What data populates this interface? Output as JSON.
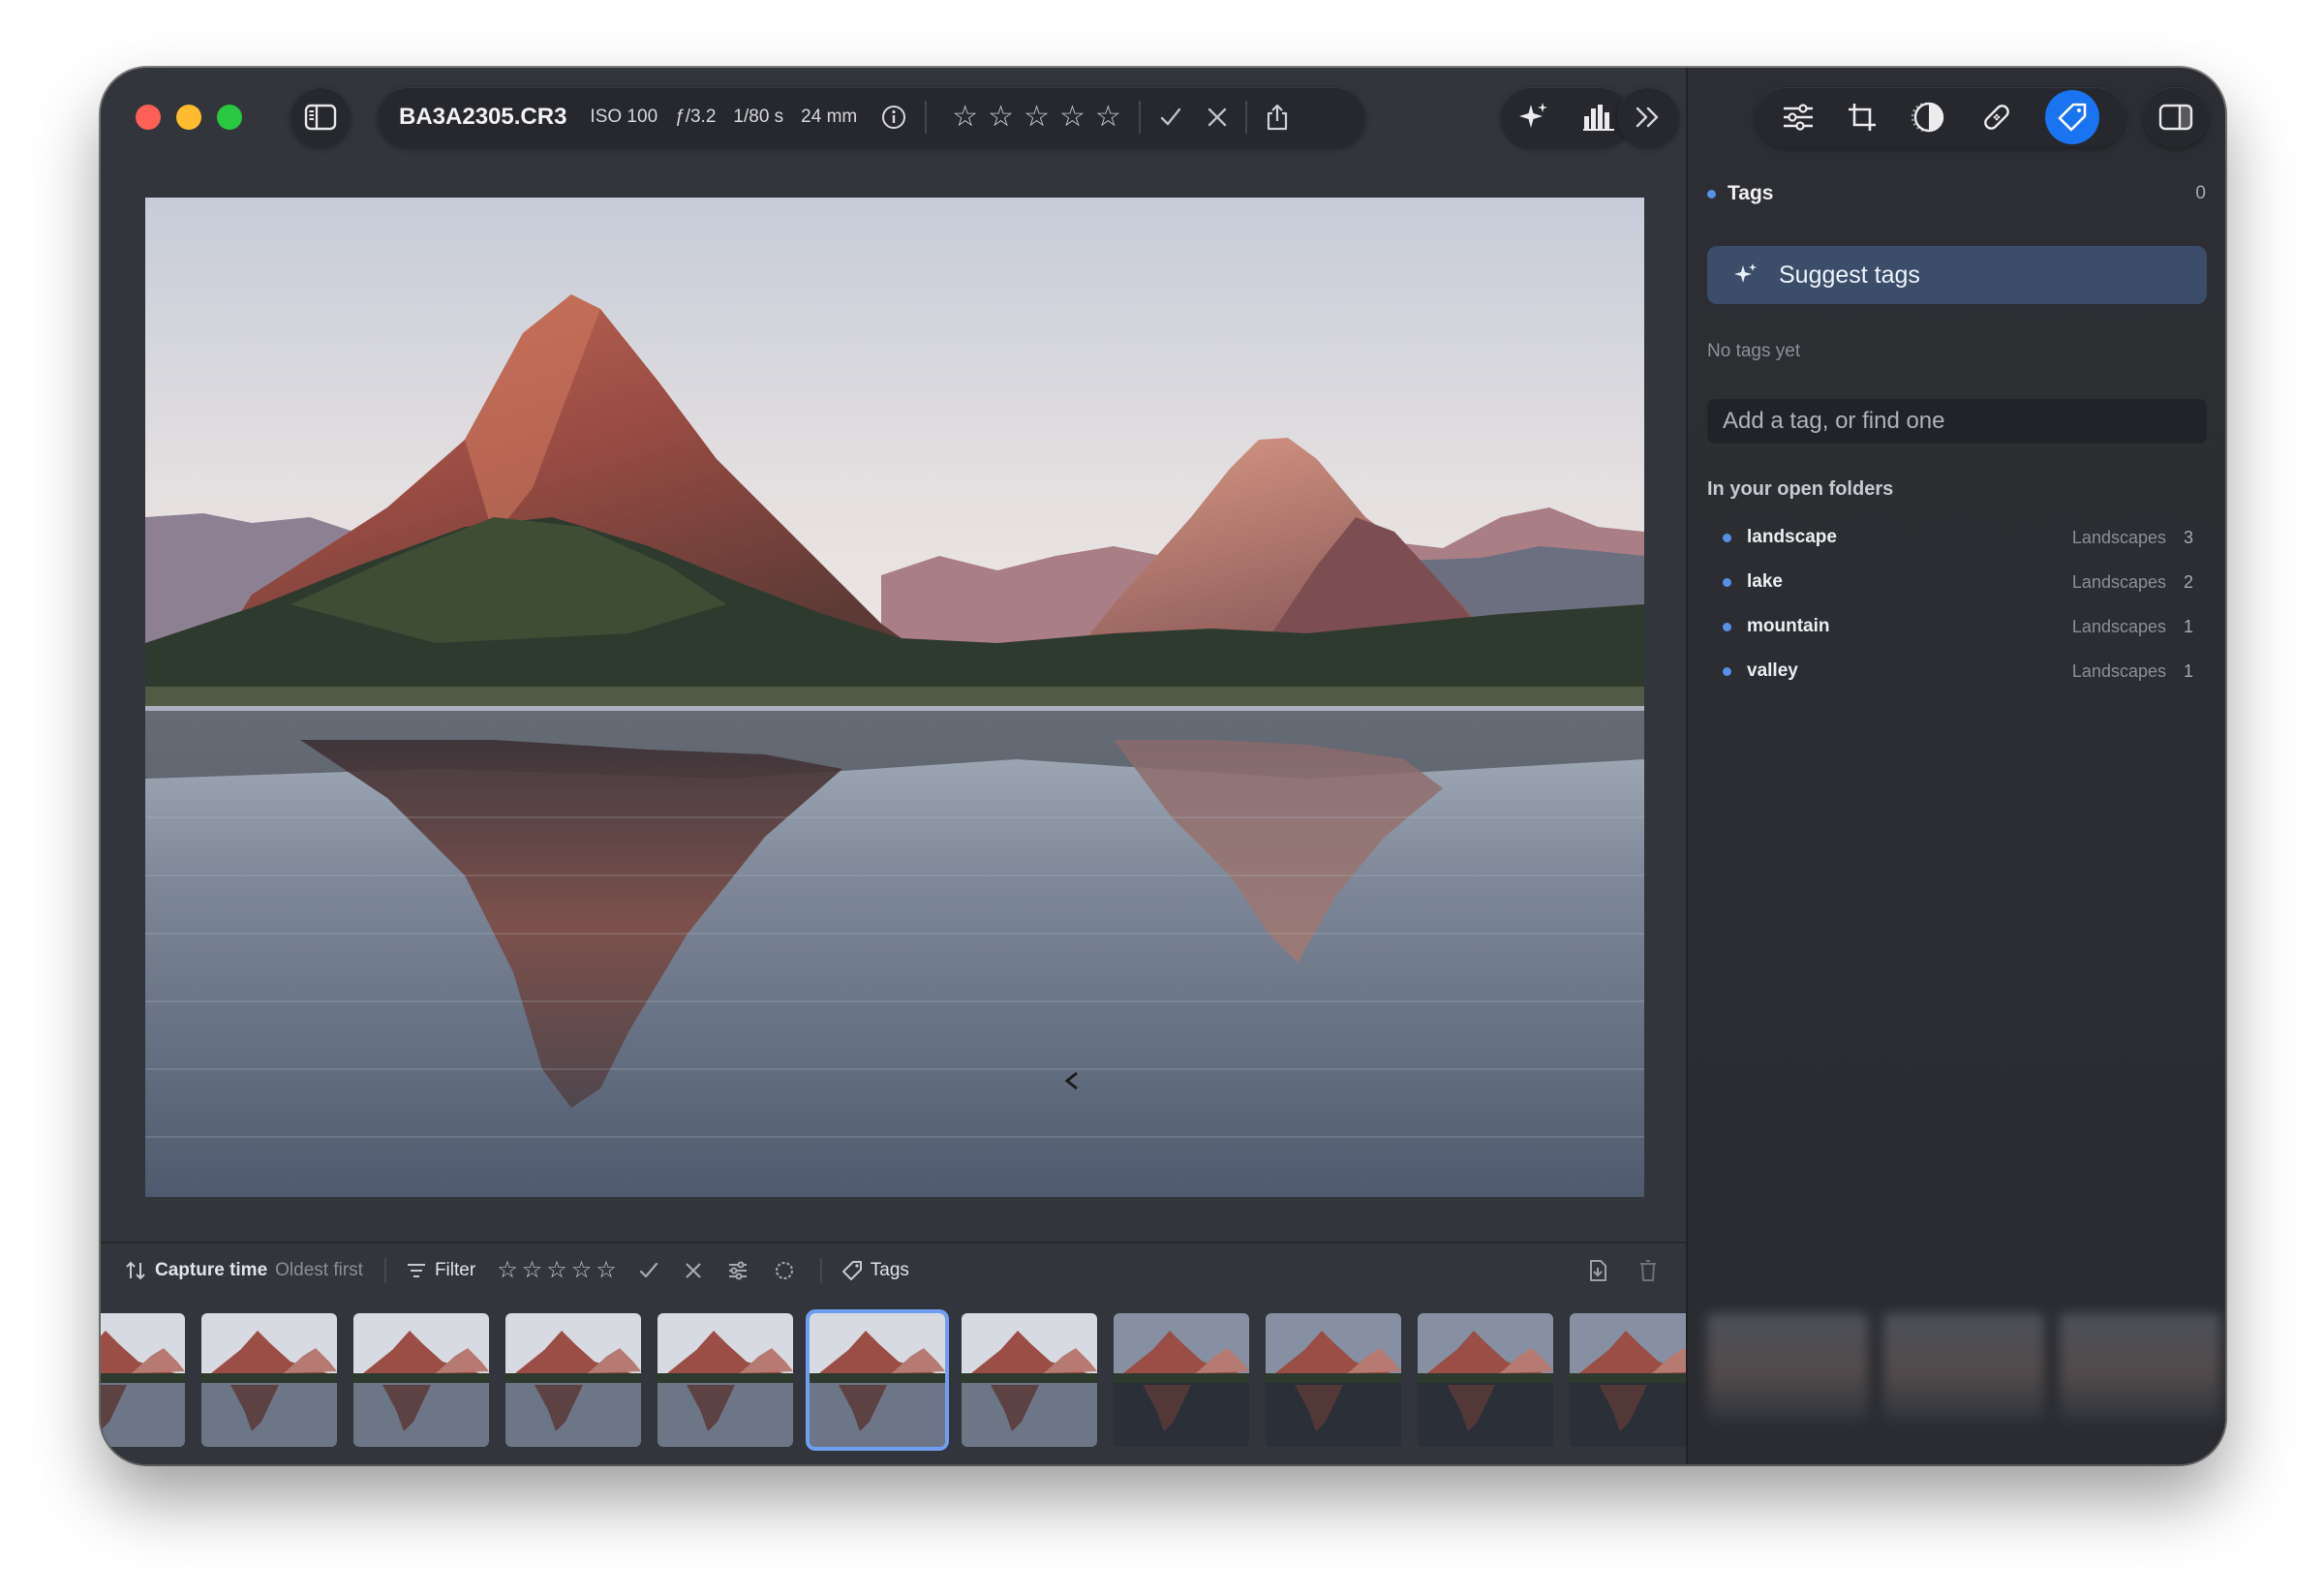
{
  "toolbar": {
    "filename": "BA3A2305.CR3",
    "iso": "ISO 100",
    "aperture": "ƒ/3.2",
    "shutter": "1/80 s",
    "focal": "24 mm",
    "rating": 0,
    "rating_max": 5,
    "icons": [
      "sidebar-left-icon",
      "info-icon",
      "check-icon",
      "x-icon",
      "share-icon",
      "sparkle-icon",
      "histogram-icon",
      "chevron-double-right-icon",
      "sliders-icon",
      "crop-icon",
      "mask-icon",
      "bandage-icon",
      "tag-icon",
      "sidebar-right-icon"
    ]
  },
  "bottom_bar": {
    "sort_label": "Capture time",
    "sort_order": "Oldest first",
    "filter_label": "Filter",
    "tags_label": "Tags"
  },
  "filmstrip": {
    "count": 11,
    "selected_index": 5
  },
  "sidebar": {
    "tags_title": "Tags",
    "tags_count": "0",
    "suggest_label": "Suggest tags",
    "empty_text": "No tags yet",
    "add_placeholder": "Add a tag, or find one",
    "section_title": "In your open folders",
    "tags": [
      {
        "name": "landscape",
        "folder": "Landscapes",
        "count": "3"
      },
      {
        "name": "lake",
        "folder": "Landscapes",
        "count": "2"
      },
      {
        "name": "mountain",
        "folder": "Landscapes",
        "count": "1"
      },
      {
        "name": "valley",
        "folder": "Landscapes",
        "count": "1"
      }
    ]
  },
  "colors": {
    "accent": "#1a73f0",
    "selection": "#6f9ef2",
    "tag_dot": "#5a8fe8"
  }
}
